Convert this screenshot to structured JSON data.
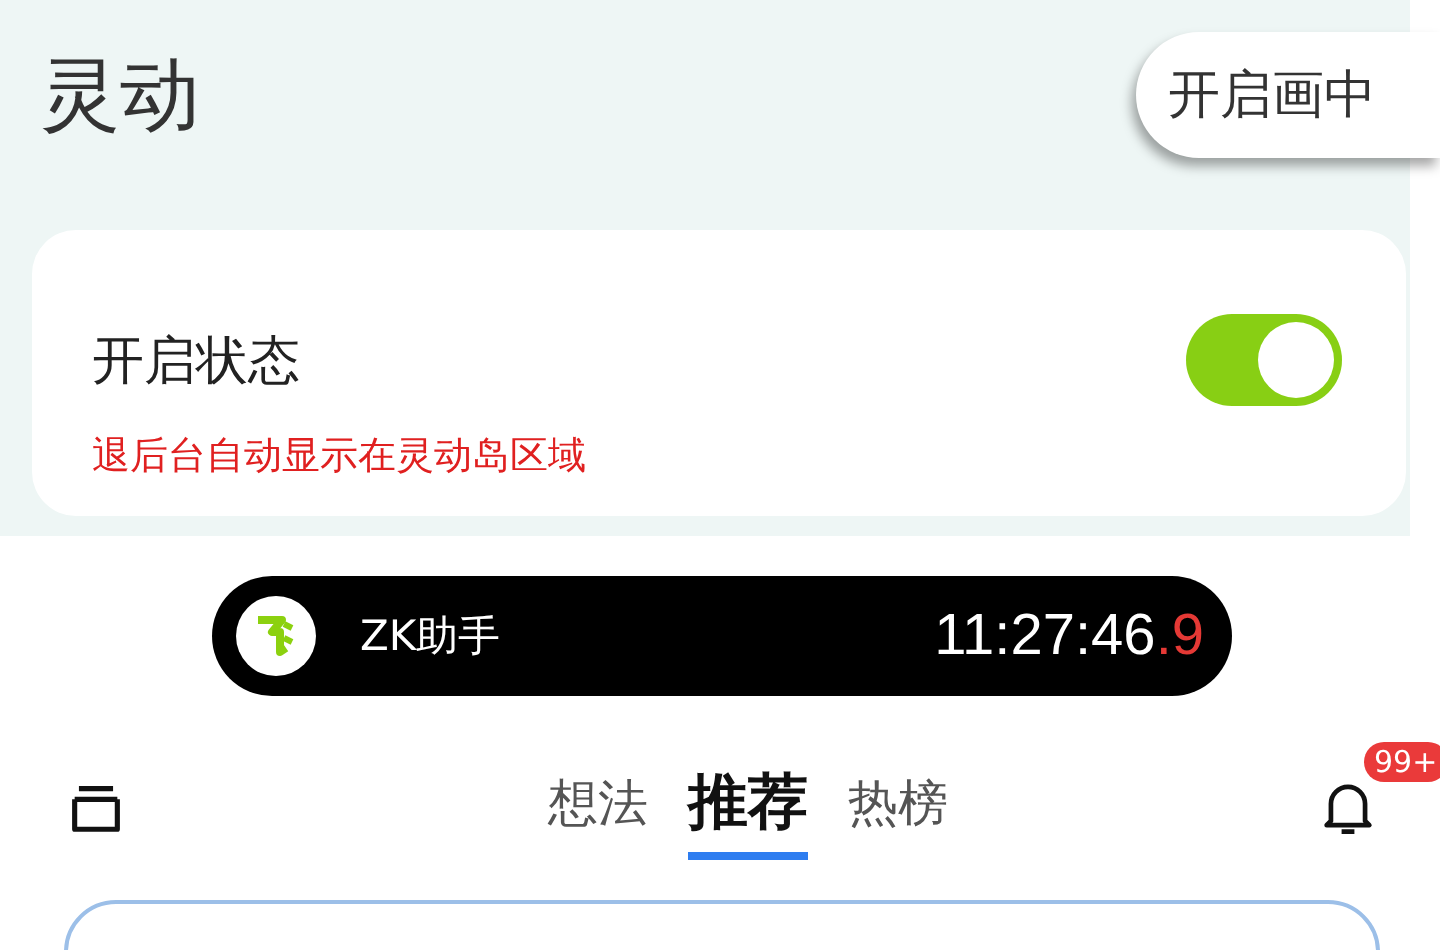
{
  "header": {
    "title": "灵动",
    "pip_button": "开启画中"
  },
  "setting": {
    "label": "开启状态",
    "description": "退后台自动显示在灵动岛区域",
    "on": true
  },
  "island": {
    "app_name": "ZK助手",
    "time": "11:27:46",
    "time_fraction": ".9"
  },
  "nav": {
    "tabs": [
      {
        "label": "想法",
        "selected": false
      },
      {
        "label": "推荐",
        "selected": true
      },
      {
        "label": "热榜",
        "selected": false
      }
    ],
    "badge": "99+"
  }
}
